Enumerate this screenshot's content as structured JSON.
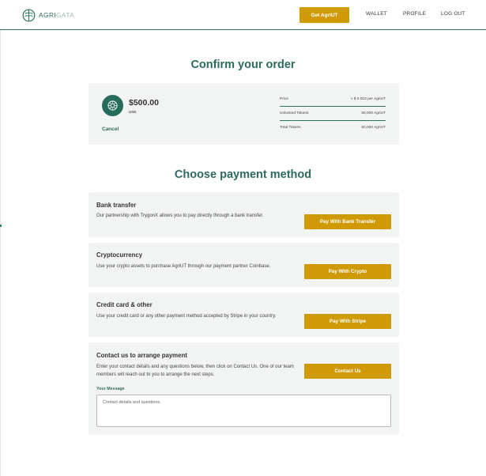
{
  "header": {
    "logo_agri": "AGRI",
    "logo_gata": "GATA",
    "get_button": "Get AgriUT",
    "nav": [
      "WALLET",
      "PROFILE",
      "LOG OUT"
    ]
  },
  "order": {
    "title": "Confirm your order",
    "amount": "$500.00",
    "currency": "USD",
    "cancel": "Cancel",
    "rows": [
      {
        "label": "Price",
        "value": "≈ $ 0.010 per AgriUT"
      },
      {
        "label": "Unlocked Tokens",
        "value": "50,000 AgriUT"
      },
      {
        "label": "Total Tokens",
        "value": "50,000 AgriUT"
      }
    ]
  },
  "payment": {
    "title": "Choose payment method",
    "methods": [
      {
        "title": "Bank transfer",
        "description": "Our partnership with TrygonX allows you to pay directly through a bank transfer.",
        "button": "Pay With Bank Transfer"
      },
      {
        "title": "Cryptocurrency",
        "description": "Use your crypto assets to purchase AgriUT through our payment partner Coinbase.",
        "button": "Pay With Crypto"
      },
      {
        "title": "Credit card & other",
        "description": "Use your credit card or any other payment method accepted by Stripe in your country.",
        "button": "Pay With Stripe"
      },
      {
        "title": "Contact us to arrange payment",
        "description": "Enter your contact details and any questions below, then click on Contact Us. One of our team members will reach out to you to arrange the next steps.",
        "button": "Contact Us"
      }
    ],
    "message_label": "Your Message",
    "message_placeholder": "Contact details and questions."
  },
  "colors": {
    "brand_green": "#2b6b5d",
    "accent_gold": "#d09a06",
    "card_bg": "#f2f3f3"
  }
}
